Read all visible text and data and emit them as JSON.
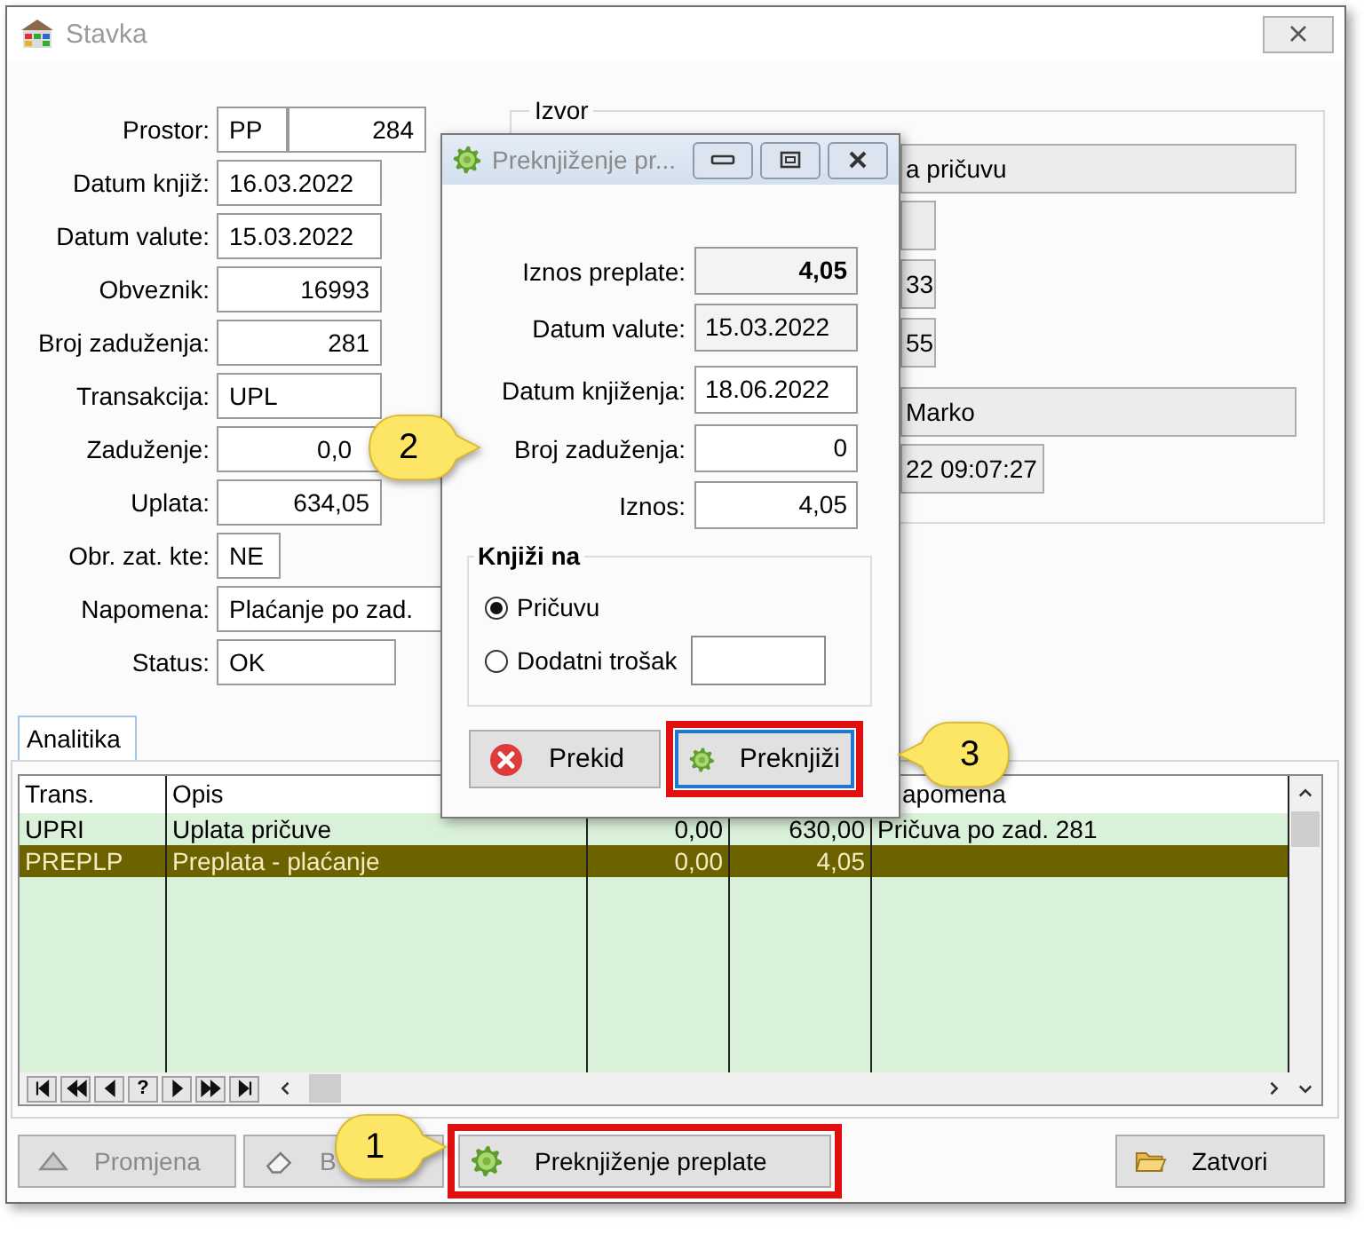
{
  "window": {
    "title": "Stavka"
  },
  "form": [
    {
      "label": "Prostor:",
      "values": [
        "PP",
        "284"
      ]
    },
    {
      "label": "Datum knjiž:",
      "values": [
        "16.03.2022"
      ]
    },
    {
      "label": "Datum valute:",
      "values": [
        "15.03.2022"
      ]
    },
    {
      "label": "Obveznik:",
      "values": [
        "16993"
      ]
    },
    {
      "label": "Broj zaduženja:",
      "values": [
        "281"
      ]
    },
    {
      "label": "Transakcija:",
      "values": [
        "UPL"
      ]
    },
    {
      "label": "Zaduženje:",
      "values": [
        "0,0"
      ]
    },
    {
      "label": "Uplata:",
      "values": [
        "634,05"
      ]
    },
    {
      "label": "Obr. zat. kte:",
      "values": [
        "NE"
      ]
    },
    {
      "label": "Napomena:",
      "values": [
        "Plaćanje po zad."
      ]
    },
    {
      "label": "Status:",
      "values": [
        "OK"
      ]
    }
  ],
  "izvor": {
    "title": "Izvor",
    "values": [
      "a pričuvu",
      "33",
      "55",
      "Marko",
      "22 09:07:27"
    ]
  },
  "tabs": [
    {
      "label": "Analitika",
      "selected": true
    }
  ],
  "table": {
    "columns": [
      "Trans.",
      "Opis",
      null,
      null,
      "apomena"
    ],
    "rows": [
      {
        "cells": [
          "UPRI",
          "Uplata pričuve",
          "0,00",
          "630,00",
          "Pričuva po zad. 281"
        ],
        "selected": false
      },
      {
        "cells": [
          "PREPLP",
          "Preplata - plaćanje",
          "0,00",
          "4,05"
        ],
        "selected": true
      }
    ],
    "navigator": [
      {
        "kind": "first"
      },
      {
        "kind": "prev-page"
      },
      {
        "kind": "prev"
      },
      {
        "kind": "help",
        "label": "?"
      },
      {
        "kind": "next"
      },
      {
        "kind": "next-page"
      },
      {
        "kind": "last"
      }
    ]
  },
  "buttons": [
    {
      "label": "Promjena",
      "disabled": true,
      "highlighted": false
    },
    {
      "label": "B",
      "disabled": true,
      "highlighted": false
    },
    {
      "label": "Preknjiženje preplate",
      "disabled": false,
      "highlighted": true
    },
    {
      "label": "Zatvori",
      "disabled": false,
      "highlighted": false
    }
  ],
  "dialog": {
    "title": "Preknjiženje pr...",
    "fields": [
      {
        "label": "Iznos preplate:",
        "value": "4,05",
        "readonly": true,
        "bold": true
      },
      {
        "label": "Datum valute:",
        "value": "15.03.2022",
        "readonly": true,
        "bold": false
      },
      {
        "label": "Datum knjiženja:",
        "value": "18.06.2022",
        "readonly": false,
        "bold": false
      },
      {
        "label": "Broj zaduženja:",
        "value": "0",
        "readonly": false,
        "bold": false
      },
      {
        "label": "Iznos:",
        "value": "4,05",
        "readonly": false,
        "bold": false
      }
    ],
    "group": {
      "title": "Knjiži na",
      "options": [
        {
          "label": "Pričuvu",
          "selected": true
        },
        {
          "label": "Dodatni trošak",
          "selected": false
        }
      ]
    },
    "buttons": [
      {
        "label": "Prekid",
        "highlighted": false
      },
      {
        "label": "Preknjiži",
        "highlighted": true
      }
    ]
  },
  "callouts": [
    {
      "label": "1"
    },
    {
      "label": "2"
    },
    {
      "label": "3"
    }
  ]
}
